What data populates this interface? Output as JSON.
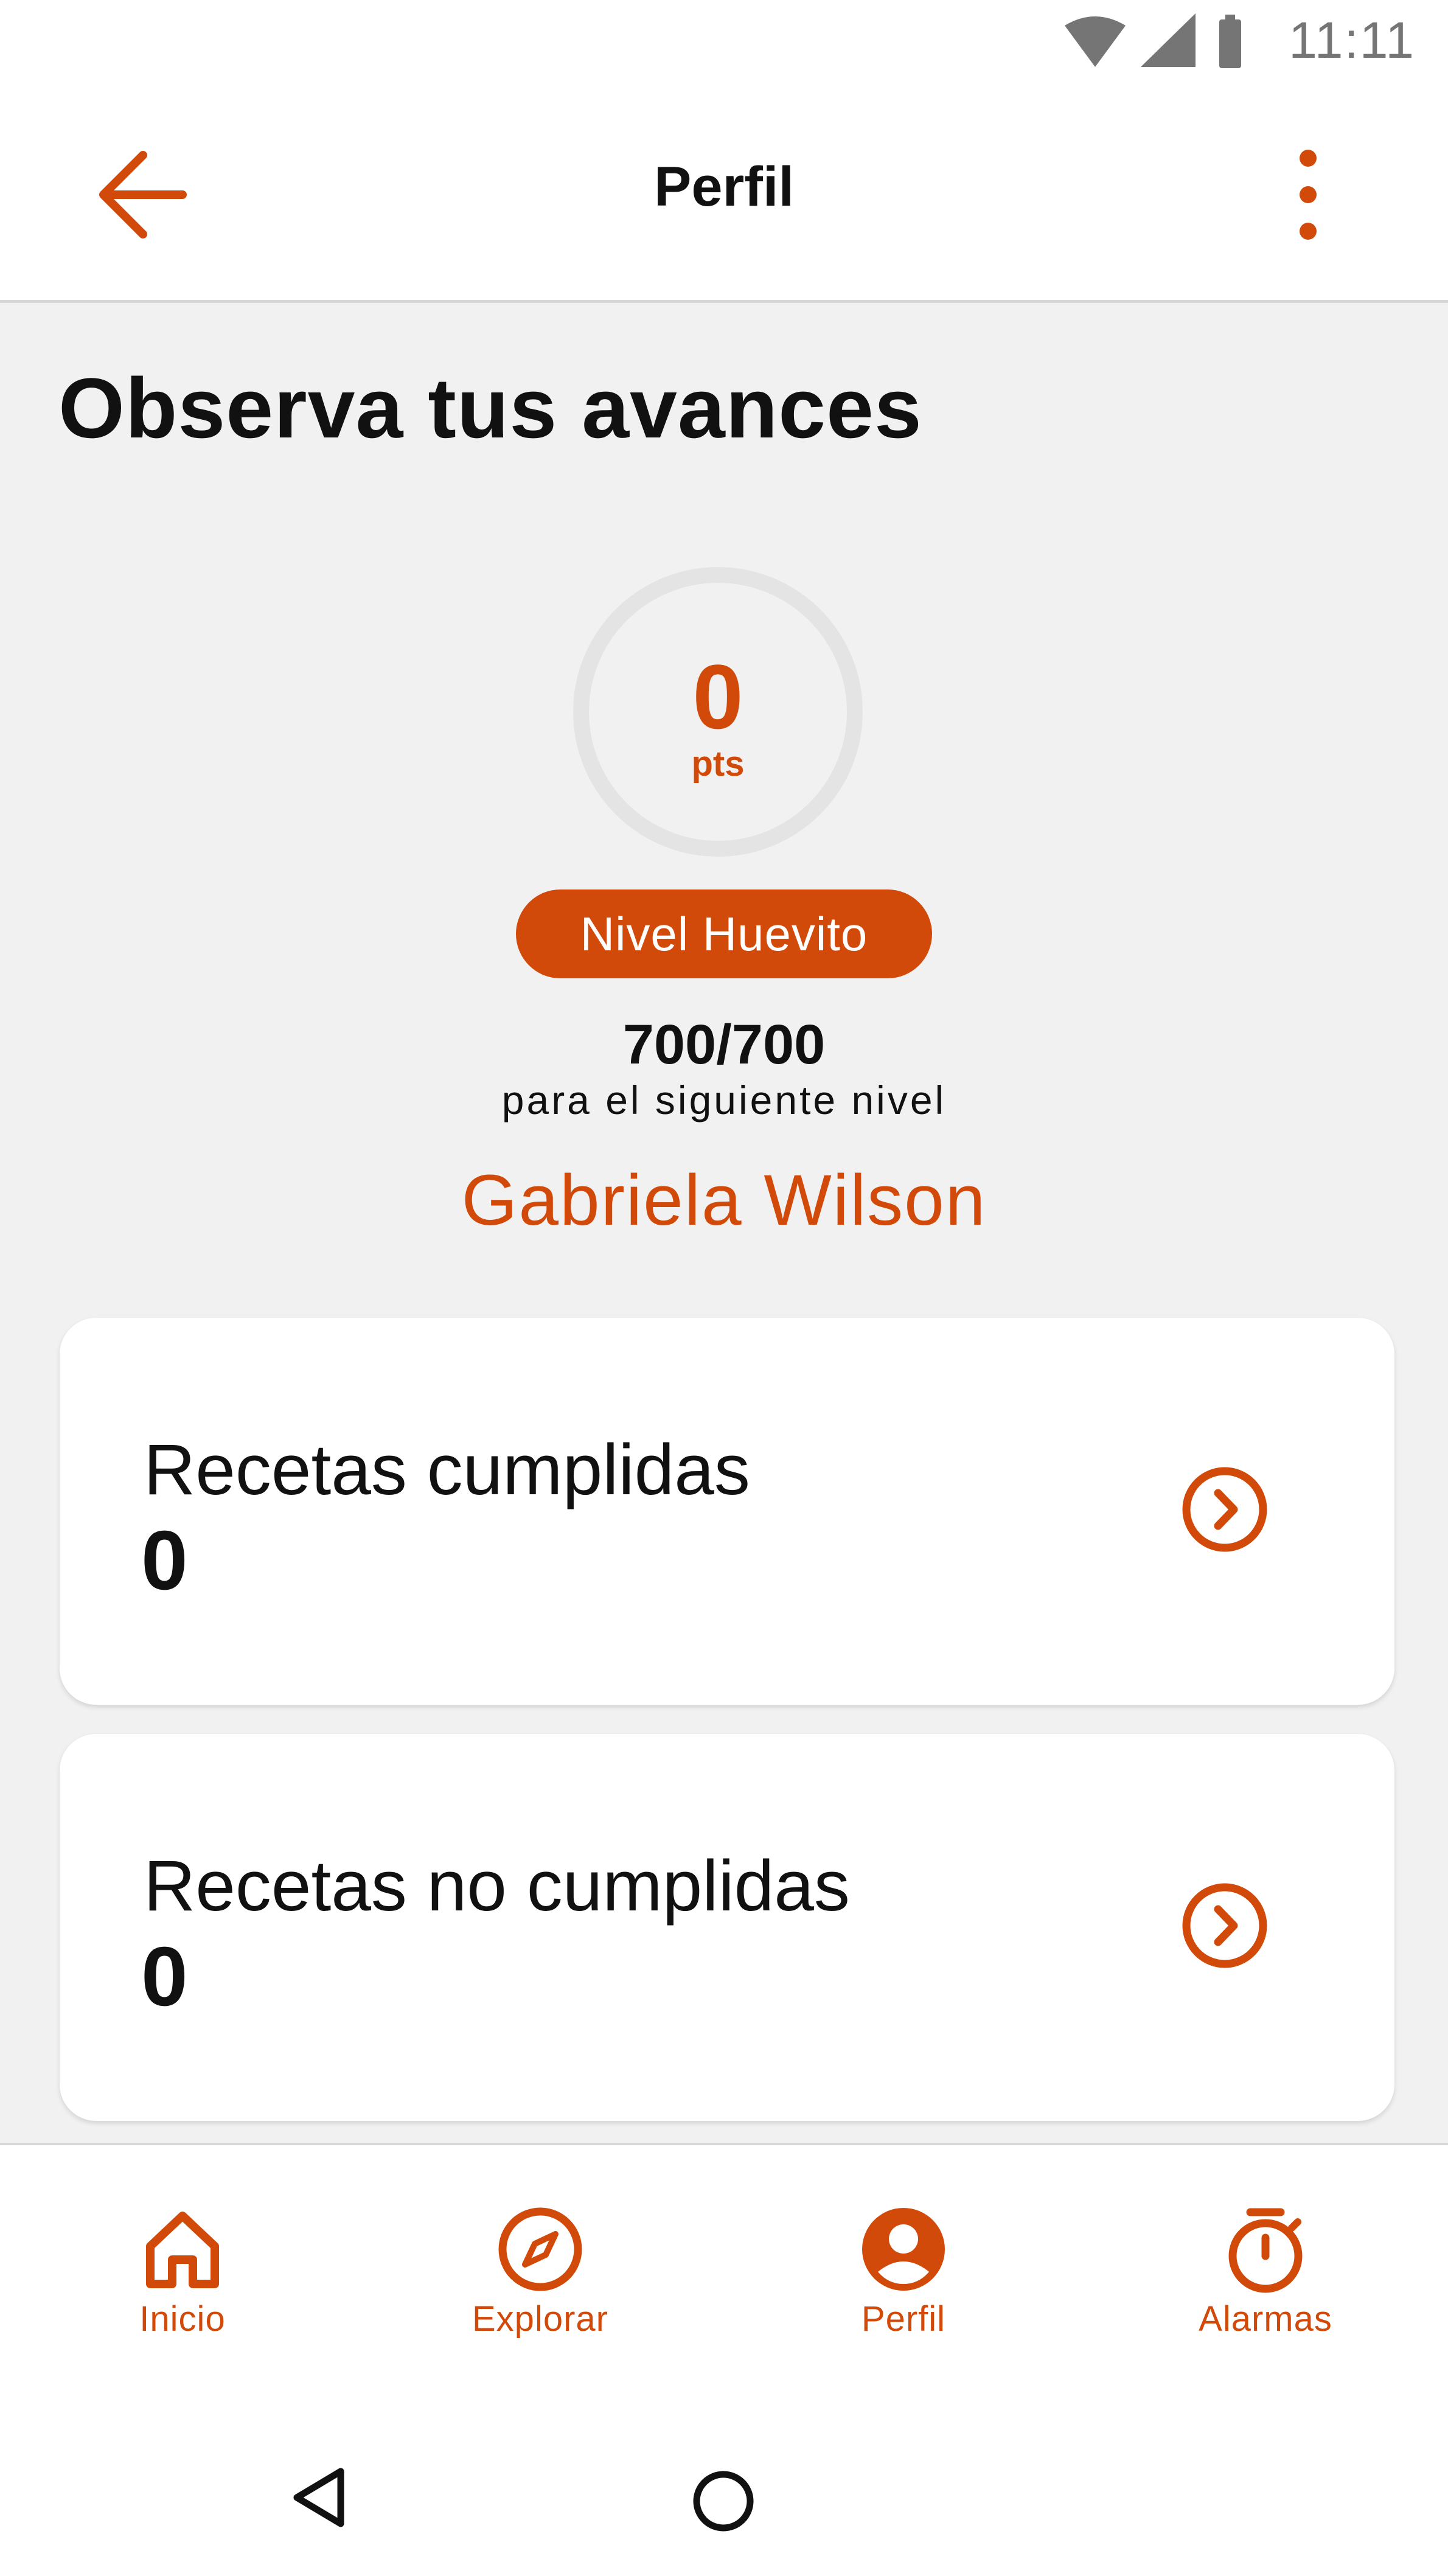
{
  "status_bar": {
    "time": "11:11"
  },
  "app_bar": {
    "title": "Perfil"
  },
  "main": {
    "heading": "Observa tus avances",
    "points": {
      "value": "0",
      "unit": "pts",
      "progress_fraction": 0
    },
    "level_badge": "Nivel Huevito",
    "next_level": {
      "value": "700/700",
      "label": "para el siguiente nivel"
    },
    "user_name": "Gabriela Wilson",
    "cards": [
      {
        "label": "Recetas cumplidas",
        "count": "0"
      },
      {
        "label": "Recetas no cumplidas",
        "count": "0"
      }
    ]
  },
  "bottom_nav": {
    "items": [
      {
        "label": "Inicio",
        "icon": "home-icon"
      },
      {
        "label": "Explorar",
        "icon": "compass-icon"
      },
      {
        "label": "Perfil",
        "icon": "account-icon"
      },
      {
        "label": "Alarmas",
        "icon": "timer-icon"
      }
    ]
  },
  "colors": {
    "accent": "#d24a0a",
    "background": "#f1f1f1",
    "surface": "#ffffff",
    "ring_track": "#e4e4e4"
  }
}
